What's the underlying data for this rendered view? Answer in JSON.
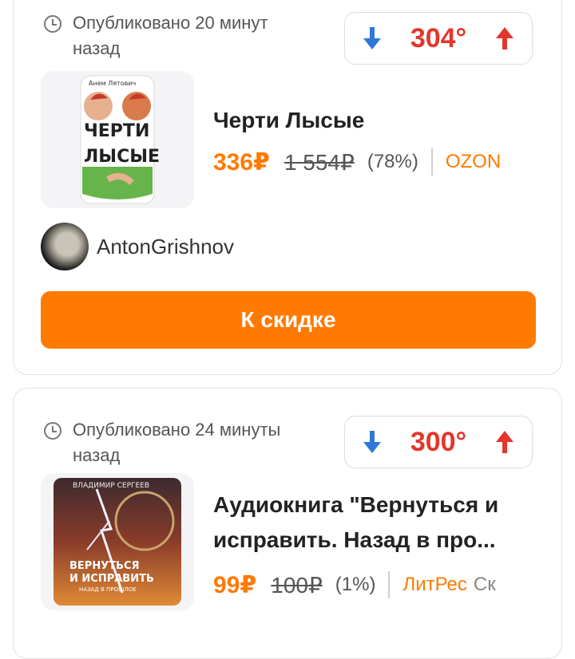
{
  "deals": [
    {
      "published": "Опубликовано 20 минут назад",
      "temperature": "304°",
      "book_cover": {
        "author": "Анем Лятович",
        "title_line1": "ЧЕРТИ",
        "title_line2": "ЛЫСЫЕ"
      },
      "title": "Черти Лысые",
      "price": "336₽",
      "old_price": "1 554₽",
      "discount": "(78%)",
      "shop": "OZON",
      "author": "AntonGrishnov",
      "cta_label": "К скидке"
    },
    {
      "published": "Опубликовано 24 минуты назад",
      "temperature": "300°",
      "book_cover": {
        "author": "ВЛАДИМИР СЕРГЕЕВ",
        "title_line1": "ВЕРНУТЬСЯ",
        "title_line2": "И ИСПРАВИТЬ",
        "subtitle": "НАЗАД В ПРОШЛОЕ"
      },
      "title": "Аудиокнига \"Вернуться и исправить. Назад в про...",
      "price": "99₽",
      "old_price": "100₽",
      "discount": "(1%)",
      "shop": "ЛитРес",
      "shop_extra": "Ск"
    }
  ],
  "colors": {
    "accent": "#ff7a00",
    "hot": "#e3362c",
    "cold": "#2f78d6"
  }
}
